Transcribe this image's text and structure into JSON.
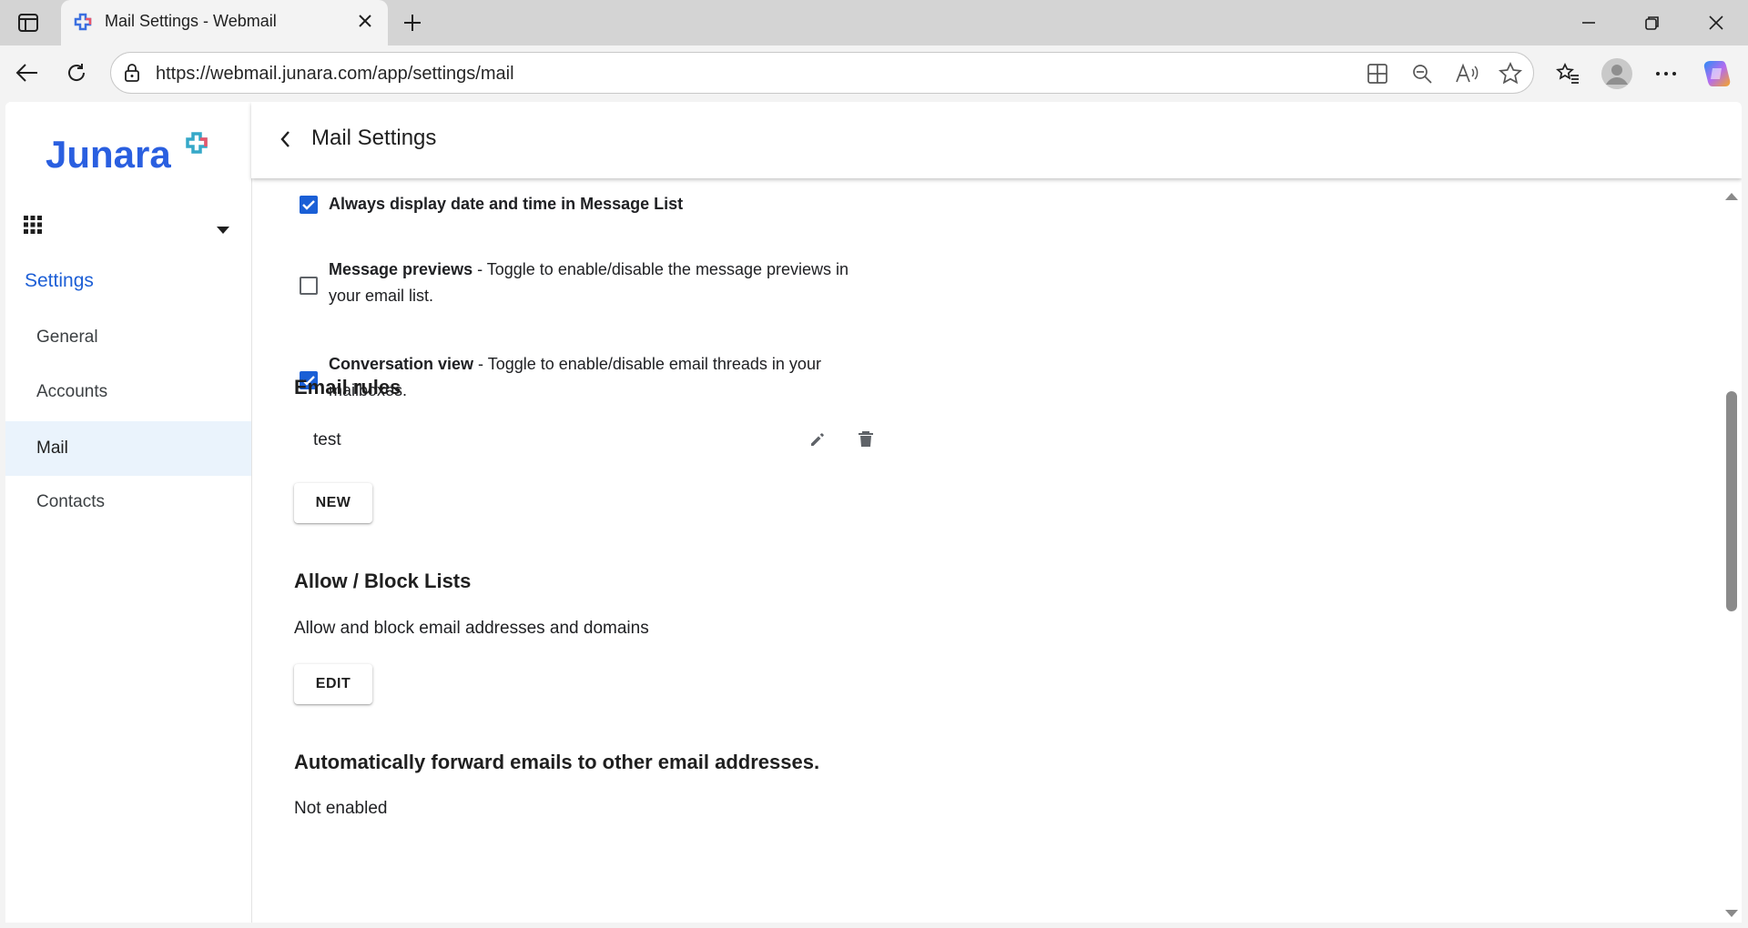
{
  "browser": {
    "tab_title": "Mail Settings - Webmail",
    "url": "https://webmail.junara.com/app/settings/mail",
    "icons": [
      "sidebar-toggle-icon",
      "new-tab-icon",
      "minimize-icon",
      "restore-icon",
      "close-window-icon",
      "back-icon",
      "refresh-icon",
      "lock-icon",
      "app-available-icon",
      "zoom-out-icon",
      "read-aloud-icon",
      "favorite-star-icon",
      "favorites-icon",
      "profile-icon",
      "more-icon",
      "copilot-icon"
    ]
  },
  "sidebar": {
    "brand": "Junara",
    "heading": "Settings",
    "items": [
      {
        "label": "General"
      },
      {
        "label": "Accounts"
      },
      {
        "label": "Mail",
        "active": true
      },
      {
        "label": "Contacts"
      }
    ]
  },
  "header": {
    "title": "Mail Settings"
  },
  "options": [
    {
      "title": "Always display date and time in Message List",
      "desc": "",
      "checked": true
    },
    {
      "title": "Message previews",
      "desc": " - Toggle to enable/disable the message previews in your email list.",
      "checked": false
    },
    {
      "title": "Conversation view",
      "desc": " - Toggle to enable/disable email threads in your mailboxes.",
      "checked": true
    }
  ],
  "email_rules": {
    "title": "Email rules",
    "rules": [
      {
        "name": "test"
      }
    ],
    "new_label": "NEW"
  },
  "allow_block": {
    "title": "Allow / Block Lists",
    "desc": "Allow and block email addresses and domains",
    "edit_label": "EDIT"
  },
  "forward": {
    "title": "Automatically forward emails to other email addresses.",
    "status": "Not enabled"
  },
  "colors": {
    "accent": "#1a5fd6",
    "active_bg": "#eaf3fc"
  }
}
